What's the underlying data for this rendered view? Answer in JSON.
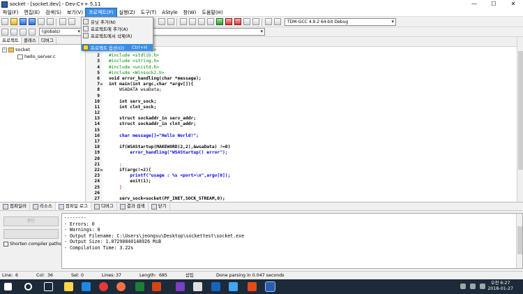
{
  "window": {
    "title": "socket - [socket.dev] - Dev-C++ 5.11",
    "minimize": "—",
    "maximize": "☐",
    "close": "✕"
  },
  "menu": [
    {
      "label": "파일(F)"
    },
    {
      "label": "편집(E)"
    },
    {
      "label": "검색(S)"
    },
    {
      "label": "보기(V)"
    },
    {
      "label": "프로젝트(P)",
      "active": true
    },
    {
      "label": "실행(Z)"
    },
    {
      "label": "도구(T)"
    },
    {
      "label": "AStyle"
    },
    {
      "label": "창(W)"
    },
    {
      "label": "도움말(H)"
    }
  ],
  "project_menu": {
    "items": [
      {
        "label": "유닛 추가(N)"
      },
      {
        "label": "프로젝트에 추가(A)"
      },
      {
        "label": "프로젝트에서 삭제(R)"
      }
    ],
    "selected": {
      "label": "프로젝트 옵션(O)",
      "shortcut": "Ctrl+H"
    }
  },
  "toolbar": {
    "compiler": "TDM-GCC 4.9.2 64-bit Debug",
    "scope": "(globals)"
  },
  "left_panel": {
    "tabs": [
      "프로젝트",
      "클래스",
      "디버그"
    ],
    "project": "socket",
    "files": [
      "hello_server.c"
    ]
  },
  "code": [
    {
      "n": "1",
      "t": "#include <stdio.h>",
      "c": "pp"
    },
    {
      "n": "2",
      "t": "#include <stdlib.h>",
      "c": "pp"
    },
    {
      "n": "3",
      "t": "#include <string.h>",
      "c": "pp"
    },
    {
      "n": "4",
      "t": "#include <unistd.h>",
      "c": "pp"
    },
    {
      "n": "5",
      "t": "#include <Winsock2.h>",
      "c": "pp"
    },
    {
      "n": "6",
      "t": "void error_handling(char *message);",
      "c": "kw"
    },
    {
      "n": "7",
      "t": "int main(int argc,char *argv[]){",
      "c": "kw",
      "fold": "⊟"
    },
    {
      "n": "8",
      "t": "    WSADATA wsaData;",
      "c": ""
    },
    {
      "n": "9",
      "t": "",
      "c": ""
    },
    {
      "n": "10",
      "t": "    int serv_sock;",
      "c": "kw"
    },
    {
      "n": "11",
      "t": "    int clnt_sock;",
      "c": "kw"
    },
    {
      "n": "12",
      "t": "",
      "c": ""
    },
    {
      "n": "13",
      "t": "    struct sockaddr_in serv_addr;",
      "c": "kw"
    },
    {
      "n": "14",
      "t": "    struct sockaddr_in clnt_addr;",
      "c": "kw"
    },
    {
      "n": "15",
      "t": "",
      "c": ""
    },
    {
      "n": "16",
      "t": "    char message[]=\"Hello World!\";",
      "c": "str"
    },
    {
      "n": "17",
      "t": "",
      "c": ""
    },
    {
      "n": "18",
      "t": "    if(WSAStartup(MAKEWORD(2,2),&wsaData) !=0)",
      "c": "kw"
    },
    {
      "n": "19",
      "t": "        error_handling(\"WSAStartup() error\");",
      "c": "str"
    },
    {
      "n": "20",
      "t": "",
      "c": ""
    },
    {
      "n": "21",
      "t": "    ;",
      "c": "red"
    },
    {
      "n": "22",
      "t": "    if(argc!=2){",
      "c": "kw",
      "fold": "⊟"
    },
    {
      "n": "23",
      "t": "        printf(\"usage : %s <port>\\n\",argv[0]);",
      "c": "str"
    },
    {
      "n": "24",
      "t": "        exit(1);",
      "c": "kw"
    },
    {
      "n": "25",
      "t": "    }",
      "c": "red"
    },
    {
      "n": "26",
      "t": "",
      "c": ""
    },
    {
      "n": "27",
      "t": "    serv_sock=socket(PF_INET,SOCK_STREAM,0);",
      "c": "kw"
    }
  ],
  "bottom_tabs": [
    "컴파일러",
    "리소스",
    "컴파일 로그",
    "디버그",
    "결과 검색",
    "닫기"
  ],
  "bottom_left": {
    "abort_label": "중단",
    "shorten_label": "Shorten compiler paths"
  },
  "log": [
    "--------",
    "- Errors: 0",
    "- Warnings: 0",
    "- Output Filename: C:\\Users\\jeongsu\\Desktop\\sockettest\\socket.exe",
    "- Output Size: 1.07290840148926 MiB",
    "- Compilation Time: 3.22s"
  ],
  "status": {
    "line_label": "Line:",
    "line": "6",
    "col_label": "Col:",
    "col": "36",
    "sel_label": "Sel:",
    "sel": "0",
    "lines_label": "Lines:",
    "lines": "37",
    "length_label": "Length:",
    "length": "685",
    "mode": "삽입",
    "message": "Done parsing in 0.047 seconds"
  },
  "taskbar": {
    "time": "오전 6:27",
    "date": "2018-01-27"
  }
}
